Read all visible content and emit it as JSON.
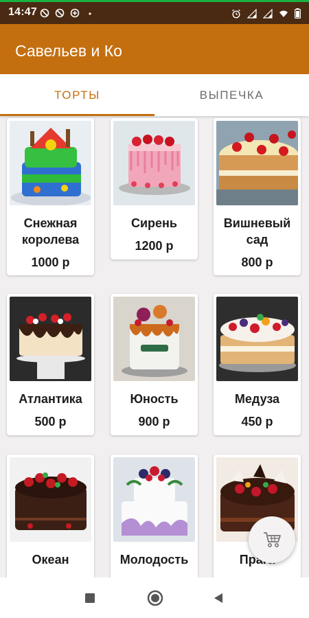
{
  "status_bar": {
    "time": "14:47",
    "left_icons": [
      "no-signal-icon",
      "no-signal-icon",
      "data-saver-icon",
      "dot-icon"
    ],
    "right_icons": [
      "alarm-icon",
      "signal-icon",
      "signal-icon",
      "wifi-icon",
      "battery-icon"
    ]
  },
  "app_bar": {
    "title": "Савельев и Ко",
    "color": "#c46f0f"
  },
  "tabs": [
    {
      "label": "ТОРТЫ",
      "active": true
    },
    {
      "label": "ВЫПЕЧКА",
      "active": false
    }
  ],
  "products": [
    {
      "name": "Снежная королева",
      "price": "1000 р"
    },
    {
      "name": "Сирень",
      "price": "1200 р"
    },
    {
      "name": "Вишневый сад",
      "price": "800 р"
    },
    {
      "name": "Атлантика",
      "price": "500 р"
    },
    {
      "name": "Юность",
      "price": "900 р"
    },
    {
      "name": "Медуза",
      "price": "450 р"
    },
    {
      "name": "Океан",
      "price": ""
    },
    {
      "name": "Молодость",
      "price": ""
    },
    {
      "name": "Прага",
      "price": ""
    }
  ],
  "fab": {
    "icon": "cart-icon"
  },
  "nav": {
    "buttons": [
      "recents-square-icon",
      "home-circle-icon",
      "back-triangle-icon"
    ]
  }
}
